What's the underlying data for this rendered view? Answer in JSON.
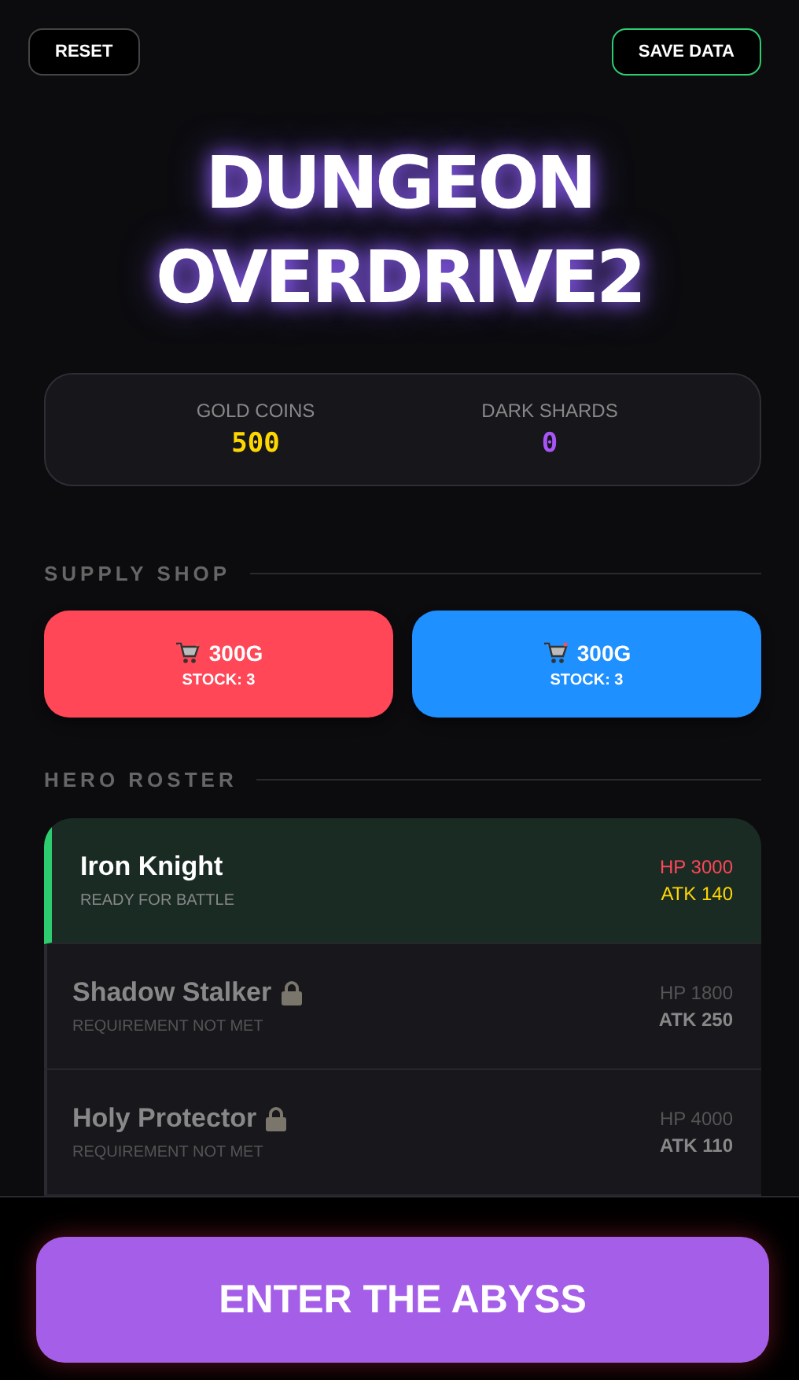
{
  "top_bar": {
    "reset_button": "RESET",
    "save_button": "SAVE DATA"
  },
  "title": [
    "DUNGEON",
    "OVERDRIVE2"
  ],
  "stats": [
    {
      "label": "GOLD COINS",
      "value": "500",
      "color": "#ffd700"
    },
    {
      "label": "DARK SHARDS",
      "value": "0",
      "color": "#a855f7"
    }
  ],
  "supply_shop": {
    "heading": "SUPPLY SHOP",
    "items": [
      {
        "price": "300G",
        "stock": "STOCK: 3",
        "color": "#ff4757"
      },
      {
        "price": "300G",
        "stock": "STOCK: 3",
        "color": "#1e90ff"
      }
    ]
  },
  "hero_roster": {
    "heading": "HERO ROSTER",
    "heroes": [
      {
        "name": "Iron Knight",
        "status": "READY FOR BATTLE",
        "hp": "HP 3000",
        "atk": "ATK 140",
        "selected": true,
        "locked": false
      },
      {
        "name": "Shadow Stalker",
        "status": "REQUIREMENT NOT MET",
        "hp": "HP 1800",
        "atk": "ATK 250",
        "selected": false,
        "locked": true
      },
      {
        "name": "Holy Protector",
        "status": "REQUIREMENT NOT MET",
        "hp": "HP 4000",
        "atk": "ATK 110",
        "selected": false,
        "locked": true
      }
    ]
  },
  "enter_button": "ENTER THE ABYSS"
}
